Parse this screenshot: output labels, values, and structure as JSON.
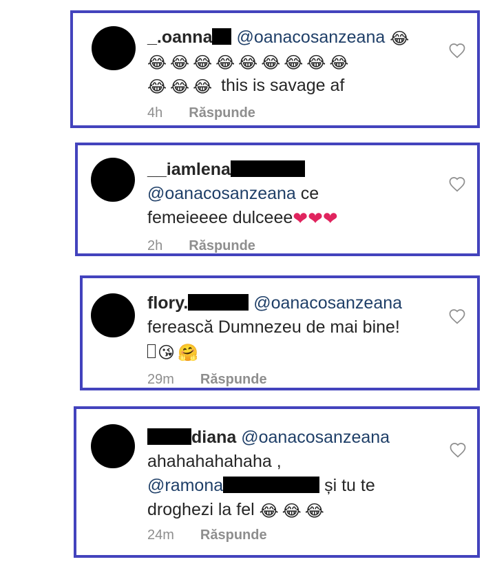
{
  "comments": [
    {
      "username": "_.oanna",
      "mention": "@oanacosanzeana",
      "emojis_row1": "😂",
      "emojis_row2": "😂😂😂😂😂😂😂😂😂",
      "emojis_row3": "😂😂😂",
      "text": "this is savage af",
      "time": "4h",
      "reply_label": "Răspunde",
      "like_icon": "heart-outline-icon"
    },
    {
      "username": "__iamlena",
      "mention": "@oanacosanzeana",
      "text_line1": "ce",
      "text_line2": "femeieeee dulceee",
      "hearts": "❤❤❤",
      "time": "2h",
      "reply_label": "Răspunde",
      "like_icon": "heart-outline-icon"
    },
    {
      "username": "flory.",
      "mention": "@oanacosanzeana",
      "text": "ferească Dumnezeu de mai bine!",
      "emojis": "😘🤗",
      "time": "29m",
      "reply_label": "Răspunde",
      "like_icon": "heart-outline-icon"
    },
    {
      "username": "diana",
      "mention": "@oanacosanzeana",
      "text_line1": "ahahahahahaha ,",
      "mention2": "@ramona",
      "text_line2": "și tu te",
      "text_line3": "droghezi la fel",
      "emojis": "😂😂😂",
      "time": "24m",
      "reply_label": "Răspunde",
      "like_icon": "heart-outline-icon"
    }
  ],
  "colors": {
    "border": "#4343bd",
    "mention": "#1f3f68",
    "meta": "#8e8e8e",
    "redaction": "#000000"
  }
}
